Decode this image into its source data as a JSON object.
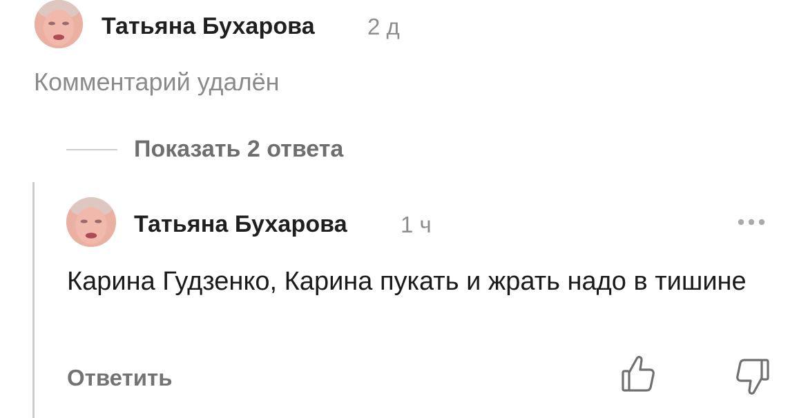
{
  "comments": [
    {
      "author": "Татьяна Бухарова",
      "time": "2 д",
      "text": "Комментарий удалён",
      "avatar_icon": "user-avatar-photo"
    }
  ],
  "replies_toggle": {
    "label": "Показать 2 ответа"
  },
  "reply": {
    "author": "Татьяна Бухарова",
    "time": "1 ч",
    "text": "Карина Гудзенко, Карина пукать и жрать надо в тишине",
    "reply_label": "Ответить",
    "more_icon": "more-dots-icon",
    "like_icon": "thumbs-up-icon",
    "dislike_icon": "thumbs-down-icon"
  },
  "colors": {
    "name": "#1f1f1f",
    "meta": "#8d8d8d",
    "muted": "#737373",
    "thread_line": "#cccccc"
  }
}
